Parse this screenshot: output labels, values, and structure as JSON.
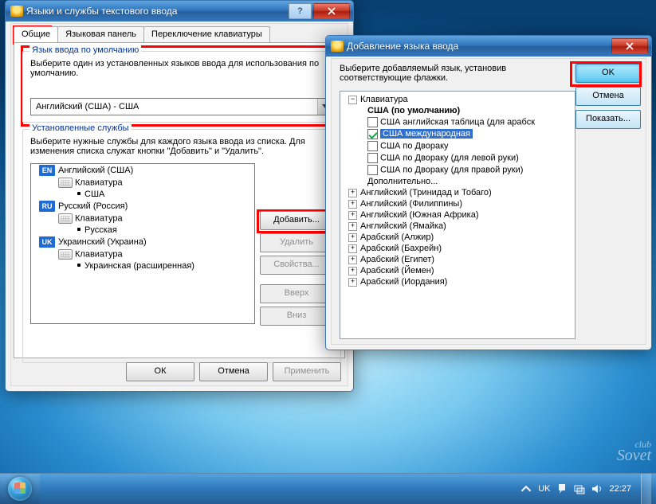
{
  "window1": {
    "title": "Языки и службы текстового ввода",
    "tabs": [
      "Общие",
      "Языковая панель",
      "Переключение клавиатуры"
    ],
    "default_group": {
      "legend": "Язык ввода по умолчанию",
      "desc": "Выберите один из установленных языков ввода для использования по умолчанию.",
      "selected": "Английский (США) - США"
    },
    "installed_group": {
      "legend": "Установленные службы",
      "desc": "Выберите нужные службы для каждого языка ввода из списка. Для изменения списка служат кнопки \"Добавить\" и \"Удалить\".",
      "langs": [
        {
          "badge": "EN",
          "name": "Английский (США)",
          "kb_label": "Клавиатура",
          "layout": "США"
        },
        {
          "badge": "RU",
          "name": "Русский (Россия)",
          "kb_label": "Клавиатура",
          "layout": "Русская"
        },
        {
          "badge": "UK",
          "name": "Украинский (Украина)",
          "kb_label": "Клавиатура",
          "layout": "Украинская (расширенная)"
        }
      ],
      "btn_add": "Добавить...",
      "btn_del": "Удалить",
      "btn_prop": "Свойства...",
      "btn_up": "Вверх",
      "btn_down": "Вниз"
    },
    "dlg": {
      "ok": "ОК",
      "cancel": "Отмена",
      "apply": "Применить"
    }
  },
  "window2": {
    "title": "Добавление языка ввода",
    "desc": "Выберите добавляемый язык, установив соответствующие флажки.",
    "btn_ok": "OK",
    "btn_cancel": "Отмена",
    "btn_show": "Показать...",
    "kb_root": "Клавиатура",
    "us_default": "США (по умолчанию)",
    "layouts": [
      {
        "label": "США английская таблица (для арабск",
        "checked": false,
        "selected": false
      },
      {
        "label": "США международная",
        "checked": true,
        "selected": true
      },
      {
        "label": "США по Двораку",
        "checked": false,
        "selected": false
      },
      {
        "label": "США по Двораку (для левой руки)",
        "checked": false,
        "selected": false
      },
      {
        "label": "США по Двораку (для правой руки)",
        "checked": false,
        "selected": false
      }
    ],
    "more": "Дополнительно...",
    "langs": [
      "Английский (Тринидад и Тобаго)",
      "Английский (Филиппины)",
      "Английский (Южная Африка)",
      "Английский (Ямайка)",
      "Арабский (Алжир)",
      "Арабский (Бахрейн)",
      "Арабский (Египет)",
      "Арабский (Йемен)",
      "Арабский (Иордания)"
    ]
  },
  "taskbar": {
    "lang": "UK",
    "time": "22:27"
  },
  "watermark": {
    "l1": "club",
    "l2": "Sovet"
  }
}
